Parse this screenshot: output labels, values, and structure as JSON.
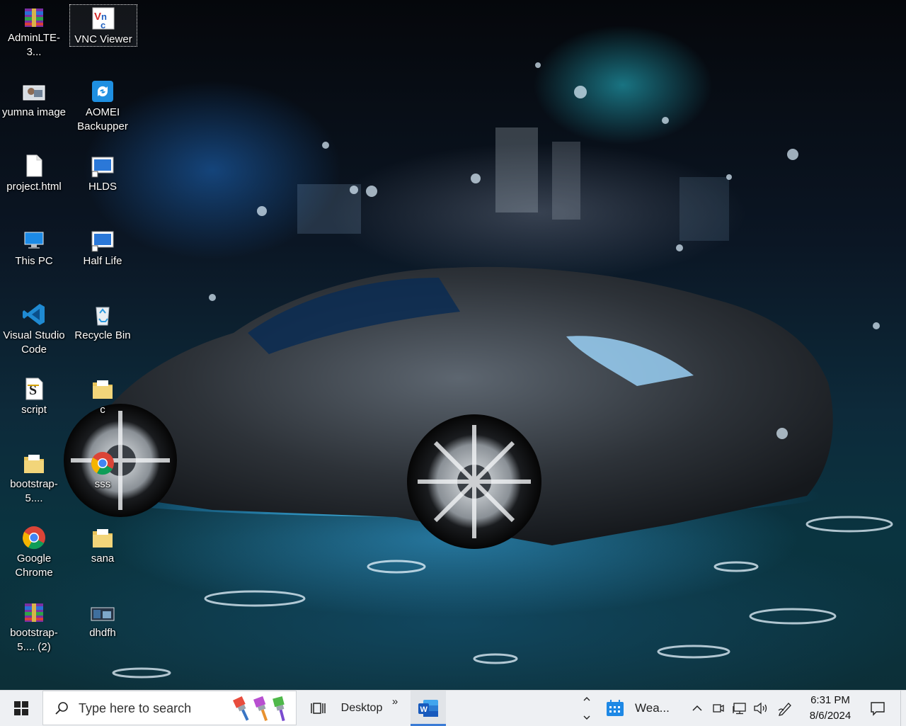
{
  "desktop": {
    "icons": [
      {
        "label": "AdminLTE-3...",
        "icon": "winrar-archive-icon"
      },
      {
        "label": "VNC Viewer",
        "icon": "vnc-viewer-icon"
      },
      {
        "label": "yumna image",
        "icon": "image-file-icon"
      },
      {
        "label": "AOMEI Backupper",
        "icon": "aomei-backupper-icon"
      },
      {
        "label": "project.html",
        "icon": "html-file-icon"
      },
      {
        "label": "HLDS",
        "icon": "hlds-app-icon"
      },
      {
        "label": "This PC",
        "icon": "this-pc-icon"
      },
      {
        "label": "Half Life",
        "icon": "half-life-app-icon"
      },
      {
        "label": "Visual Studio Code",
        "icon": "vscode-icon"
      },
      {
        "label": "Recycle Bin",
        "icon": "recycle-bin-icon"
      },
      {
        "label": "script",
        "icon": "script-file-icon"
      },
      {
        "label": "c",
        "icon": "folder-icon"
      },
      {
        "label": "bootstrap-5....",
        "icon": "folder-icon"
      },
      {
        "label": "sss",
        "icon": "chrome-icon"
      },
      {
        "label": "Google Chrome",
        "icon": "chrome-icon"
      },
      {
        "label": "sana",
        "icon": "folder-icon"
      },
      {
        "label": "bootstrap-5.... (2)",
        "icon": "winrar-archive-icon"
      },
      {
        "label": "dhdfh",
        "icon": "image-file-icon"
      }
    ]
  },
  "taskbar": {
    "search_placeholder": "Type here to search",
    "desktop_label": "Desktop",
    "overflow_label": "»",
    "weather_label": "Wea...",
    "time": "6:31 PM",
    "date": "8/6/2024"
  },
  "colors": {
    "taskbar_bg": "#eef0f3",
    "accent": "#3a7bd5",
    "icon_text": "#ffffff"
  }
}
